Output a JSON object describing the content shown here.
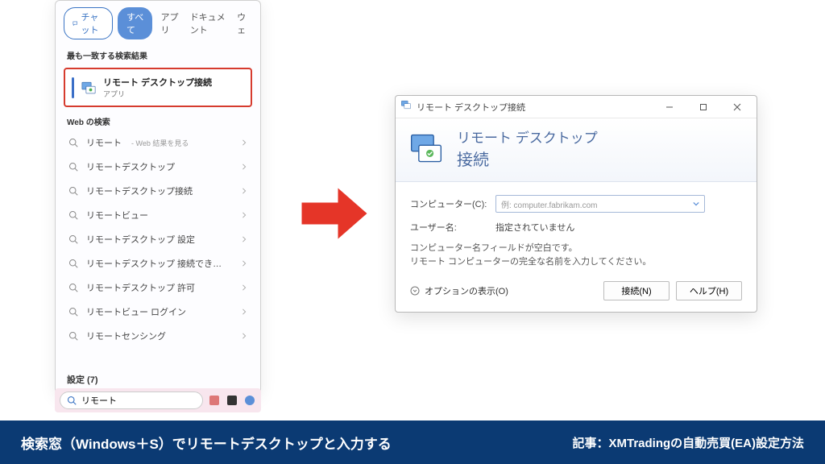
{
  "tabs": {
    "chat": "チャット",
    "all": "すべて",
    "apps": "アプリ",
    "documents": "ドキュメント",
    "web_truncated": "ウェ"
  },
  "sections": {
    "best_match": "最も一致する検索結果",
    "web_search": "Web の検索",
    "settings": "設定 (7)"
  },
  "best_match": {
    "title": "リモート デスクトップ接続",
    "subtitle": "アプリ"
  },
  "web_items": [
    {
      "label": "リモート",
      "sub": "- Web 結果を見る"
    },
    {
      "label": "リモートデスクトップ",
      "sub": ""
    },
    {
      "label": "リモートデスクトップ接続",
      "sub": ""
    },
    {
      "label": "リモートビュー",
      "sub": ""
    },
    {
      "label": "リモートデスクトップ 設定",
      "sub": ""
    },
    {
      "label": "リモートデスクトップ 接続できない",
      "sub": ""
    },
    {
      "label": "リモートデスクトップ 許可",
      "sub": ""
    },
    {
      "label": "リモートビュー ログイン",
      "sub": ""
    },
    {
      "label": "リモートセンシング",
      "sub": ""
    }
  ],
  "search_input": "リモート",
  "rdc": {
    "window_title": "リモート デスクトップ接続",
    "heading1": "リモート デスクトップ",
    "heading2": "接続",
    "computer_label": "コンピューター(C):",
    "computer_placeholder": "例: computer.fabrikam.com",
    "user_label": "ユーザー名:",
    "user_value": "指定されていません",
    "message_l1": "コンピューター名フィールドが空白です。",
    "message_l2": "リモート コンピューターの完全な名前を入力してください。",
    "options_label": "オプションの表示(O)",
    "connect_btn": "接続(N)",
    "help_btn": "ヘルプ(H)"
  },
  "caption": {
    "left": "検索窓（Windows＋S）でリモートデスクトップと入力する",
    "right": "記事：XMTradingの自動売買(EA)設定方法"
  }
}
